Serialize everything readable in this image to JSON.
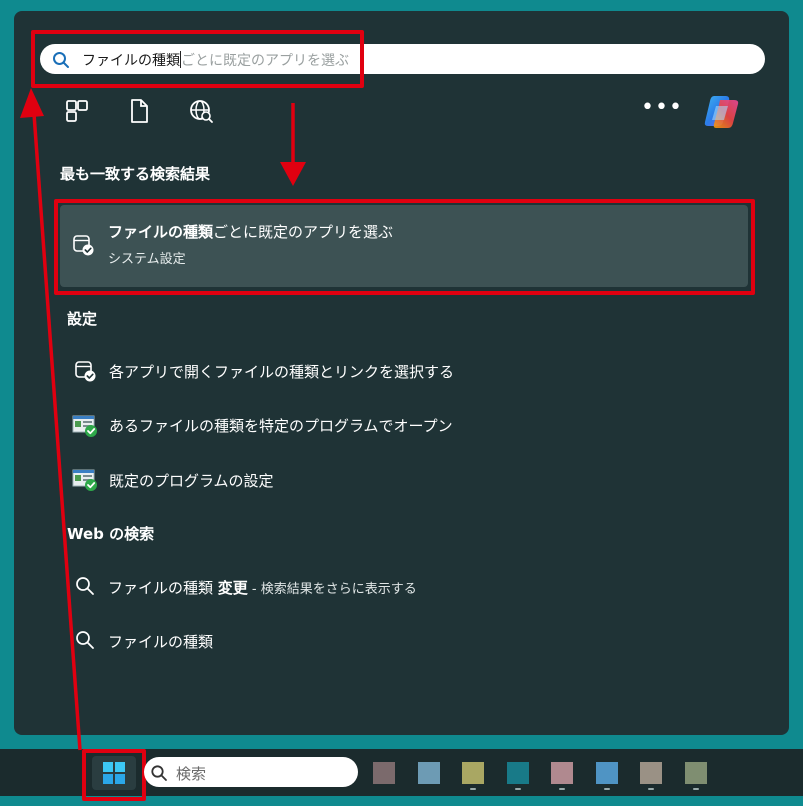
{
  "search": {
    "typed": "ファイルの種類",
    "suggestion": "ごとに既定のアプリを選ぶ"
  },
  "filters": [
    "apps-icon",
    "documents-icon",
    "web-icon"
  ],
  "more_label": "•••",
  "sections": {
    "best_match": "最も一致する検索結果",
    "settings": "設定",
    "web": "Web の検索"
  },
  "best_match": {
    "title_bold": "ファイルの種類",
    "title_rest": "ごとに既定のアプリを選ぶ",
    "subtitle": "システム設定"
  },
  "settings_items": [
    {
      "label": "各アプリで開くファイルの種類とリンクを選択する",
      "icon": "app-defaults-icon"
    },
    {
      "label": "あるファイルの種類を特定のプログラムでオープン",
      "icon": "control-panel-icon"
    },
    {
      "label": "既定のプログラムの設定",
      "icon": "control-panel-icon"
    }
  ],
  "web_items": [
    {
      "label": "ファイルの種類 ",
      "bold": "変更",
      "suffix": " - 検索結果をさらに表示する"
    },
    {
      "label": "ファイルの種類",
      "bold": "",
      "suffix": ""
    }
  ],
  "taskbar": {
    "search_label": "検索",
    "tray_colors": [
      "#7b6a6c",
      "#6d9bb4",
      "#a9a763",
      "#187a88",
      "#b0898f",
      "#4f94c4",
      "#9a9185",
      "#7f8e71"
    ]
  },
  "colors": {
    "highlight_red": "#e00010",
    "panel": "#1f3336",
    "accent_blue": "#1a7fd6"
  }
}
